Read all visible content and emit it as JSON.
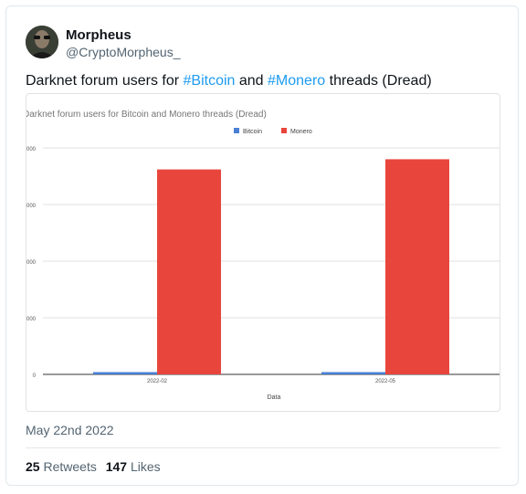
{
  "tweet": {
    "author_name": "Morpheus",
    "author_handle": "@CryptoMorpheus_",
    "text_prefix": "Darknet forum users for ",
    "hashtag1": "#Bitcoin",
    "text_mid": " and ",
    "hashtag2": "#Monero",
    "text_suffix": " threads (Dread)",
    "date": "May 22nd 2022",
    "retweets_count": "25",
    "retweets_label": "Retweets",
    "likes_count": "147",
    "likes_label": "Likes"
  },
  "chart_data": {
    "type": "bar",
    "title": "Darknet forum users for Bitcoin and Monero threads (Dread)",
    "xlabel": "Data",
    "ylabel": "",
    "categories": [
      "2022-02",
      "2022-05"
    ],
    "y_tick_labels": [
      "000",
      "000",
      "000",
      "000",
      "0"
    ],
    "ylim": [
      0,
      4000
    ],
    "grid": true,
    "legend_position": "top",
    "series": [
      {
        "name": "Bitcoin",
        "color": "#4a7fd4",
        "values": [
          40,
          40
        ]
      },
      {
        "name": "Monero",
        "color": "#e8463c",
        "values": [
          3620,
          3800
        ]
      }
    ]
  }
}
